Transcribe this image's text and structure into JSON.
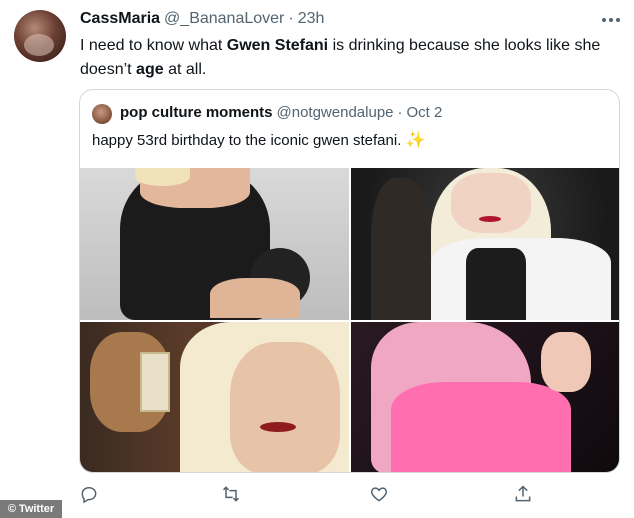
{
  "tweet": {
    "author_name": "CassMaria",
    "author_handle": "@_BananaLover",
    "separator": "·",
    "time": "23h",
    "text_part1": "I need to know what ",
    "text_bold1": "Gwen Stefani",
    "text_part2": " is drinking because she looks like she doesn’t ",
    "text_bold2": "age",
    "text_part3": " at all."
  },
  "quote": {
    "author_name": "pop culture moments",
    "author_handle": "@notgwendalupe",
    "separator": "·",
    "date": "Oct 2",
    "text": "happy 53rd birthday to the iconic gwen stefani.",
    "emoji": "✨"
  },
  "actions": {
    "icons": [
      "reply-icon",
      "retweet-icon",
      "like-icon",
      "share-icon"
    ]
  },
  "watermark": {
    "label": "Twitter"
  },
  "colors": {
    "secondary_text": "#536471",
    "border": "#cfd9de",
    "primary_text": "#0f1419"
  }
}
